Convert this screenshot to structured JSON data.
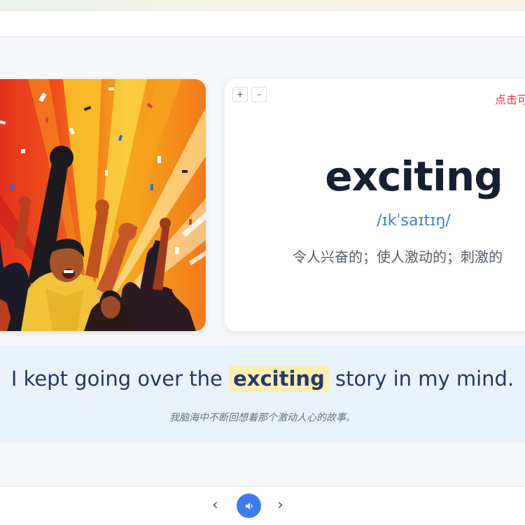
{
  "card": {
    "zoom_in_label": "+",
    "zoom_out_label": "-",
    "hint": "点击可",
    "word": "exciting",
    "phonetic": "/ɪkˈsaɪtɪŋ/",
    "meaning": "令人兴奋的；使人激动的；刺激的"
  },
  "sentence": {
    "before": "I kept going over the",
    "highlight": "exciting",
    "after": "story in my mind.",
    "translation": "我脑海中不断回想着那个激动人心的故事。"
  },
  "footer": {
    "prev_icon": "chevron-left-icon",
    "prev_glyph": "‹",
    "next_icon": "chevron-right-icon",
    "next_glyph": "›",
    "audio_icon": "speaker-icon"
  },
  "colors": {
    "accent": "#3d7cf0",
    "hint": "#e0393e",
    "phonetic": "#3b82c4",
    "highlight_bg": "#fbeeb0",
    "word": "#172033"
  },
  "illustration": {
    "icon": "cheering-crowd-illustration"
  }
}
